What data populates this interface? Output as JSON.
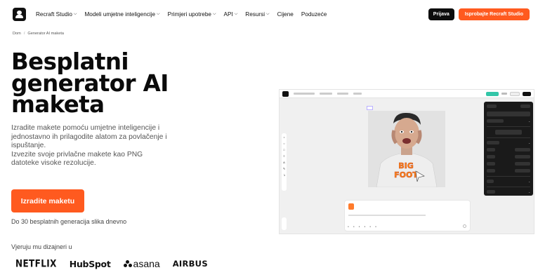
{
  "nav": {
    "items": [
      {
        "label": "Recraft Studio",
        "has_chevron": true
      },
      {
        "label": "Modeli umjetne inteligencije",
        "has_chevron": true
      },
      {
        "label": "Primjeri upotrebe",
        "has_chevron": true
      },
      {
        "label": "API",
        "has_chevron": true
      },
      {
        "label": "Resursi",
        "has_chevron": true
      },
      {
        "label": "Cijene",
        "has_chevron": false
      },
      {
        "label": "Poduzeće",
        "has_chevron": false
      }
    ],
    "login_label": "Prijava",
    "try_label": "Isprobajte Recraft Studio"
  },
  "breadcrumb": {
    "home": "Dom",
    "separator": "/",
    "current": "Generator AI maketa"
  },
  "hero": {
    "title_lines": [
      "Besplatni",
      "generator AI",
      "maketa"
    ],
    "description_lines": [
      "Izradite makete pomoću umjetne inteligencije i",
      "jednostavno ih prilagodite alatom za povlačenje i",
      "ispuštanje.",
      "Izvezite svoje privlačne makete kao PNG",
      "datoteke visoke rezolucije."
    ],
    "cta_label": "Izradite maketu",
    "free_note": "Do 30 besplatnih generacija slika dnevno",
    "trusted_label": "Vjeruju mu dizajneri u",
    "brands": [
      "NETFLIX",
      "HubSpot",
      "asana",
      "AIRBUS"
    ]
  },
  "preview": {
    "shirt_text": [
      "BIG",
      "FOOT"
    ]
  },
  "colors": {
    "accent": "#ff5a1f",
    "dark": "#0d0d0d",
    "teal": "#33c6a8"
  }
}
